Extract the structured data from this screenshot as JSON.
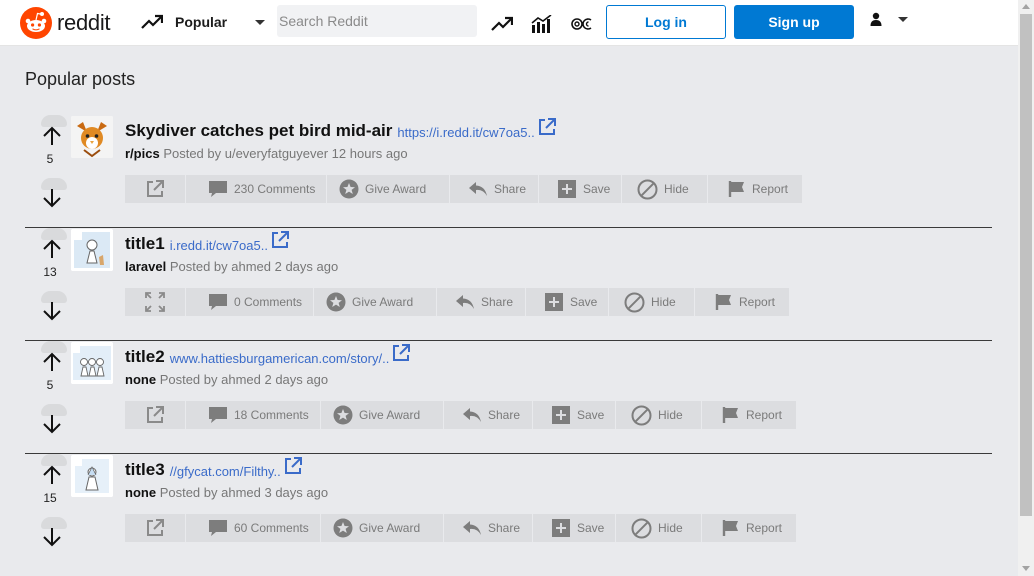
{
  "header": {
    "logo_text": "reddit",
    "feed_label": "Popular",
    "search_placeholder": "Search Reddit",
    "login_label": "Log in",
    "signup_label": "Sign up"
  },
  "page": {
    "title": "Popular posts"
  },
  "posts": [
    {
      "score": "5",
      "title": "Skydiver catches pet bird mid-air",
      "link": "https://i.redd.it/cw7oa5..",
      "subreddit": "r/pics",
      "posted_by": "Posted by u/everyfatguyever 12 hours ago",
      "comments": "230 Comments",
      "first_icon": "external-link-icon"
    },
    {
      "score": "13",
      "title": "title1",
      "link": "i.redd.it/cw7oa5..",
      "subreddit": "laravel",
      "posted_by": "Posted by ahmed 2 days ago",
      "comments": "0 Comments",
      "first_icon": "expand-icon"
    },
    {
      "score": "5",
      "title": "title2",
      "link": "www.hattiesburgamerican.com/story/..",
      "subreddit": "none",
      "posted_by": "Posted by ahmed 2 days ago",
      "comments": "18 Comments",
      "first_icon": "external-link-icon"
    },
    {
      "score": "15",
      "title": "title3",
      "link": "//gfycat.com/Filthy..",
      "subreddit": "none",
      "posted_by": "Posted by ahmed 3 days ago",
      "comments": "60 Comments",
      "first_icon": "external-link-icon"
    }
  ],
  "actions": {
    "give_award": "Give Award",
    "share": "Share",
    "save": "Save",
    "hide": "Hide",
    "report": "Report"
  },
  "colors": {
    "brand": "#ff4500",
    "accent": "#0079d3",
    "link": "#3a6bc9"
  }
}
